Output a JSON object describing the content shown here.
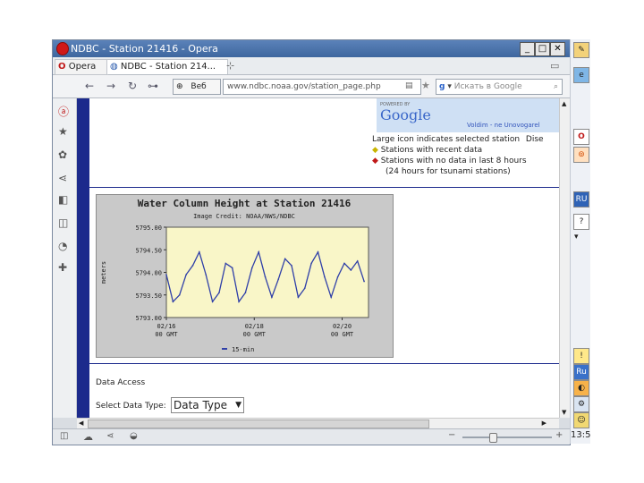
{
  "window": {
    "title": "NDBC - Station 21416 - Opera"
  },
  "tabs": {
    "menu_label": "Opera",
    "page_tab": "NDBC - Station 214... ×"
  },
  "toolbar": {
    "address": "www.ndbc.noaa.gov/station_page.php",
    "security_label": "Веб",
    "search_placeholder": "Искать в Google"
  },
  "map": {
    "powered_by": "POWERED BY",
    "google": "Google",
    "map_links": "Voldim - ne Unovogarel",
    "legend_title": "Large icon indicates selected station",
    "legend_extra": "Dise",
    "legend_recent": "Stations with recent data",
    "legend_nodata": "Stations with no data in last 8 hours",
    "legend_tsunami": "(24 hours for tsunami stations)"
  },
  "page": {
    "data_access": "Data Access",
    "select_label": "Select Data Type:",
    "select_value": "Data Type"
  },
  "status": {
    "time": "13:5"
  },
  "colors": {
    "plot_bg": "#f9f6c8",
    "line": "#2f3fa8",
    "nav": "#1c2a8c"
  },
  "chart_data": {
    "type": "line",
    "title": "Water Column Height at Station 21416",
    "credit": "Image Credit: NOAA/NWS/NDBC",
    "ylabel": "meters",
    "ylim": [
      5793.0,
      5795.0
    ],
    "yticks": [
      "5795.00",
      "5794.50",
      "5794.00",
      "5793.50",
      "5793.00"
    ],
    "xticks": [
      {
        "date": "02/16",
        "tz": "00 GMT"
      },
      {
        "date": "02/18",
        "tz": "00 GMT"
      },
      {
        "date": "02/20",
        "tz": "00 GMT"
      }
    ],
    "legend": "15-min",
    "series": [
      {
        "name": "15-min",
        "days_from_0216": [
          0.0,
          0.15,
          0.3,
          0.45,
          0.6,
          0.75,
          0.9,
          1.05,
          1.2,
          1.35,
          1.5,
          1.65,
          1.8,
          1.95,
          2.1,
          2.25,
          2.4,
          2.55,
          2.7,
          2.85,
          3.0,
          3.15,
          3.3,
          3.45,
          3.6,
          3.75,
          3.9,
          4.05,
          4.2,
          4.35,
          4.5
        ],
        "values": [
          5793.95,
          5793.35,
          5793.5,
          5793.95,
          5794.15,
          5794.45,
          5793.95,
          5793.35,
          5793.55,
          5794.2,
          5794.1,
          5793.35,
          5793.55,
          5794.1,
          5794.45,
          5793.9,
          5793.45,
          5793.85,
          5794.3,
          5794.15,
          5793.45,
          5793.65,
          5794.2,
          5794.45,
          5793.9,
          5793.45,
          5793.9,
          5794.2,
          5794.05,
          5794.25,
          5793.8
        ]
      }
    ],
    "xlim": [
      0,
      4.6
    ]
  }
}
